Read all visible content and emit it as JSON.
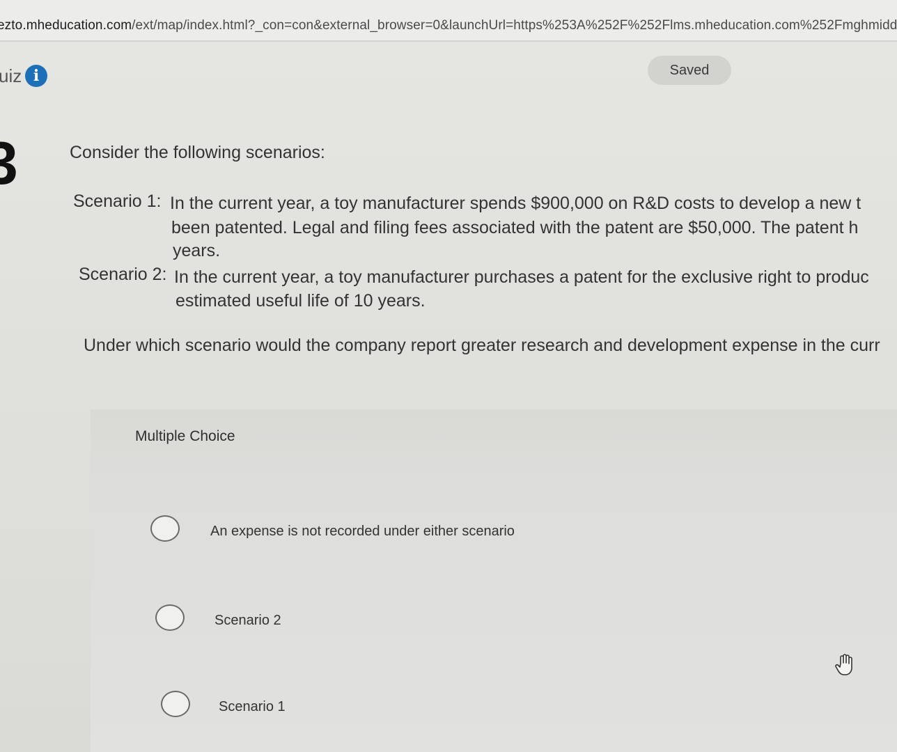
{
  "browser": {
    "url_domain": "ezto.mheducation.com",
    "url_rest": "/ext/map/index.html?_con=con&external_browser=0&launchUrl=https%253A%252F%252Flms.mheducation.com%252Fmghmiddle"
  },
  "header": {
    "quiz_label": "uiz",
    "info_icon": "info-icon",
    "saved_label": "Saved"
  },
  "question": {
    "number": "3",
    "intro": "Consider the following scenarios:",
    "scenarios": [
      {
        "label": "Scenario 1:",
        "lines": [
          "In the current year, a toy manufacturer spends $900,000 on R&D costs to develop a new t",
          "been patented. Legal and filing fees associated with the patent are $50,000. The patent h",
          "years."
        ]
      },
      {
        "label": "Scenario 2:",
        "lines": [
          "In the current year, a toy manufacturer purchases a patent for the exclusive right to produc",
          "estimated useful life of 10 years."
        ]
      }
    ],
    "prompt": "Under which scenario would the company report greater research and development expense in the curr"
  },
  "multiple_choice": {
    "heading": "Multiple Choice",
    "options": [
      {
        "label": "An expense is not recorded under either scenario",
        "selected": false
      },
      {
        "label": "Scenario 2",
        "selected": false
      },
      {
        "label": "Scenario 1",
        "selected": false
      }
    ]
  },
  "cursor": {
    "icon": "hand-pointer-icon"
  }
}
